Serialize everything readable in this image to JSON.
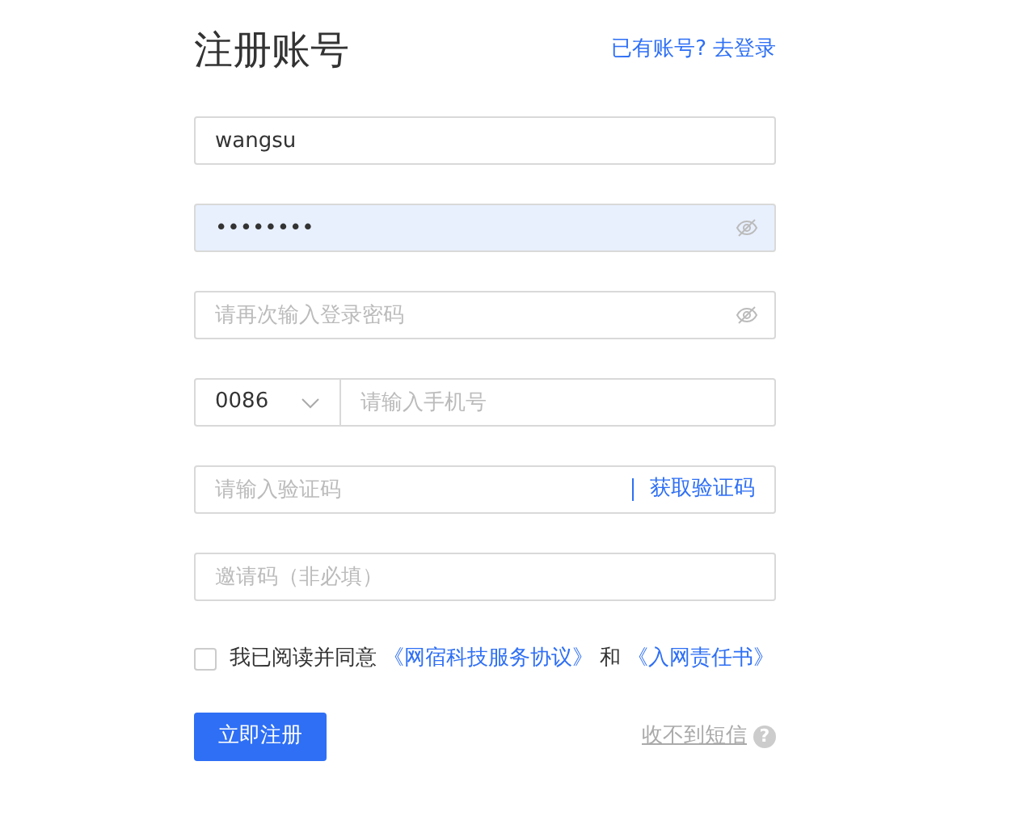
{
  "title": "注册账号",
  "login_prompt": {
    "text": "已有账号?",
    "link": "去登录"
  },
  "fields": [
    {
      "kind": "text",
      "value": "wangsu",
      "autofilled": false
    },
    {
      "kind": "password",
      "value": "••••••••",
      "autofilled": true
    },
    {
      "kind": "password",
      "placeholder": "请再次输入登录密码",
      "autofilled": false
    },
    {
      "kind": "phone",
      "country_code": "0086",
      "placeholder": "请输入手机号"
    },
    {
      "kind": "code",
      "placeholder": "请输入验证码",
      "action": "获取验证码"
    },
    {
      "kind": "text",
      "placeholder": "邀请码（非必填）",
      "autofilled": false
    }
  ],
  "agreement": {
    "checked": false,
    "text": "我已阅读并同意",
    "link1": "《网宿科技服务协议》",
    "joiner": "和",
    "link2": "《入网责任书》"
  },
  "submit": "立即注册",
  "no_sms": "收不到短信",
  "help_symbol": "?"
}
